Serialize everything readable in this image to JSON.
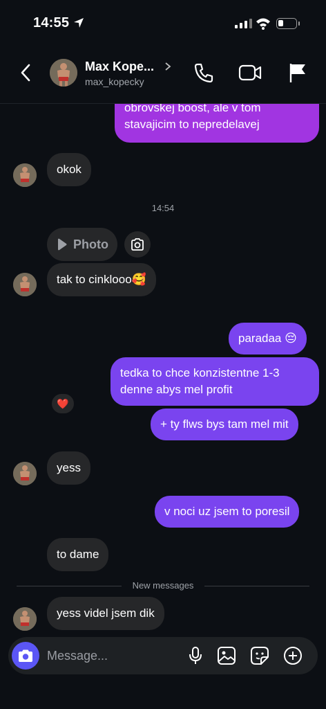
{
  "status": {
    "time": "14:55"
  },
  "header": {
    "name": "Max Kope...",
    "username": "max_kopecky"
  },
  "messages": [
    {
      "side": "sent",
      "text_lines": [
        "obrovskej boost, ale v tom",
        "stavajicim to nepredelavej"
      ]
    },
    {
      "side": "received",
      "text": "okok"
    },
    {
      "side": "received",
      "text": "tak to cinklooo🥰",
      "attachment_label": "Photo",
      "reaction": "❤️"
    },
    {
      "side": "sent",
      "text": "paradaa 😔"
    },
    {
      "side": "sent",
      "text_lines": [
        "tedka to chce konzistentne 1-3",
        "denne abys mel profit"
      ]
    },
    {
      "side": "sent",
      "text": "+ ty flws bys tam mel mit"
    },
    {
      "side": "received",
      "text": "yess"
    },
    {
      "side": "sent",
      "text": "v noci uz jsem to poresil"
    },
    {
      "side": "received",
      "text": "to dame"
    },
    {
      "side": "received",
      "text": "yess videl jsem dik"
    }
  ],
  "timestamp": "14:54",
  "divider_label": "New messages",
  "composer": {
    "placeholder": "Message..."
  },
  "icons": {
    "header": [
      "back-icon",
      "phone-icon",
      "video-icon",
      "flag-icon"
    ],
    "composer": [
      "camera-icon",
      "microphone-icon",
      "gallery-icon",
      "sticker-icon",
      "plus-icon"
    ]
  },
  "colors": {
    "background": "#0c0f14",
    "received_bubble": "#262729",
    "sent_bubble": "#7a44ef",
    "sent_bubble_top": "#a135e1",
    "camera_button": "#5b56f5"
  }
}
